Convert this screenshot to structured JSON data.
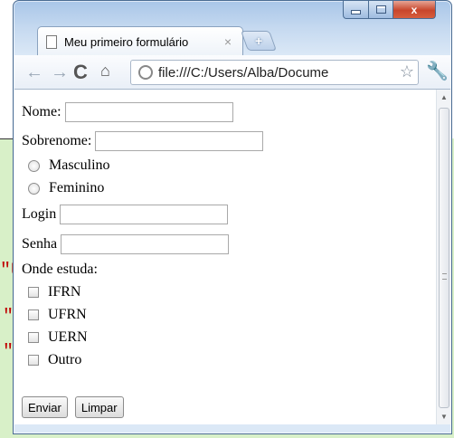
{
  "background": {
    "snippets": [
      "\"U",
      "\"",
      "\""
    ]
  },
  "browser": {
    "tab_title": "Meu primeiro formulário",
    "address": "file:///C:/Users/Alba/Docume",
    "window_controls": {
      "minimize": "",
      "maximize": "",
      "close": "x"
    },
    "new_tab": "+"
  },
  "form": {
    "nome_label": "Nome:",
    "sobrenome_label": "Sobrenome:",
    "radios": [
      "Masculino",
      "Feminino"
    ],
    "login_label": "Login",
    "senha_label": "Senha",
    "onde_label": "Onde estuda:",
    "checkboxes": [
      "IFRN",
      "UFRN",
      "UERN",
      "Outro"
    ],
    "submit_label": "Enviar",
    "reset_label": "Limpar"
  }
}
